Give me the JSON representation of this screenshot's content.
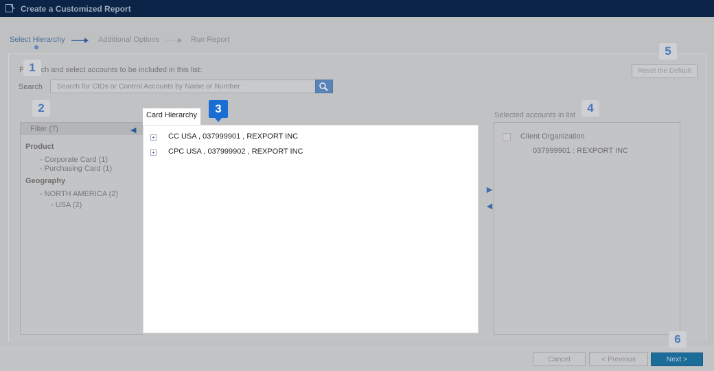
{
  "window": {
    "title": "Create a Customized Report"
  },
  "steps": [
    {
      "label": "Select Hierarchy",
      "active": true
    },
    {
      "label": "Additional Options",
      "active": false
    },
    {
      "label": "Run Report",
      "active": false
    }
  ],
  "callouts": {
    "n1": "1",
    "n2": "2",
    "n3": "3",
    "n4": "4",
    "n5": "5",
    "n6": "6"
  },
  "instructions": "P        search and select accounts to be included in this list:",
  "search": {
    "label": "Search",
    "placeholder": "Search for CIDs or Control Accounts by Name or Number"
  },
  "reset_button": "Reset the Default",
  "filter": {
    "header": "Filter (7)",
    "groups": [
      {
        "title": "Product",
        "items": [
          "- Corporate Card (1)",
          "- Purchasing Card (1)"
        ]
      },
      {
        "title": "Geography",
        "items": [
          "- NORTH AMERICA (2)",
          "- USA (2)"
        ]
      }
    ]
  },
  "tree": {
    "tab": "Card Hierarchy",
    "rows": [
      "CC USA , 037999901 , REXPORT INC",
      "CPC USA , 037999902 , REXPORT INC"
    ]
  },
  "selected": {
    "label": "Selected accounts in list",
    "org": "Client Organization",
    "account": "037999901 : REXPORT INC"
  },
  "footer": {
    "cancel": "Cancel",
    "previous": "< Previous",
    "next": "Next  >"
  },
  "colors": {
    "titlebar": "#0b2447",
    "accent": "#1a6ed3",
    "next_button": "#1b6c98"
  }
}
